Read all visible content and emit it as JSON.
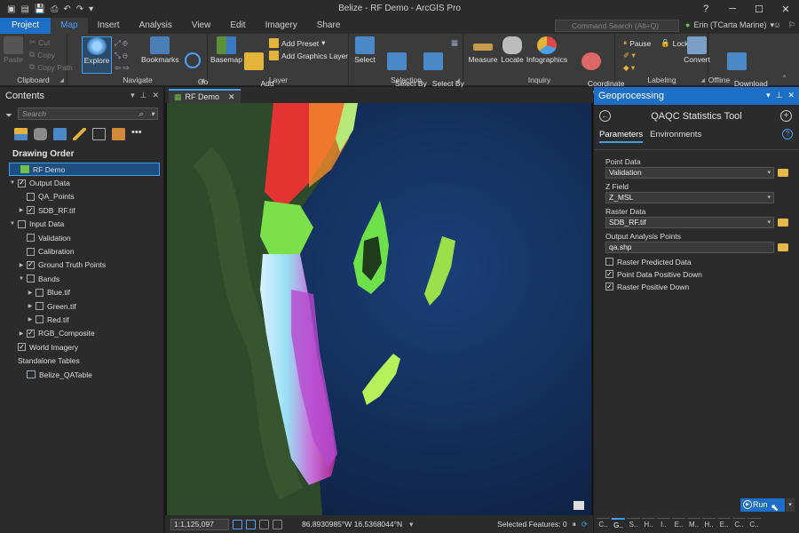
{
  "window": {
    "title": "Belize - RF Demo - ArcGIS Pro"
  },
  "ribbon_tabs": [
    {
      "label": "Project",
      "name": "tab-project"
    },
    {
      "label": "Map",
      "name": "tab-map"
    },
    {
      "label": "Insert",
      "name": "tab-insert"
    },
    {
      "label": "Analysis",
      "name": "tab-analysis"
    },
    {
      "label": "View",
      "name": "tab-view"
    },
    {
      "label": "Edit",
      "name": "tab-edit"
    },
    {
      "label": "Imagery",
      "name": "tab-imagery"
    },
    {
      "label": "Share",
      "name": "tab-share"
    }
  ],
  "command_search": {
    "placeholder": "Command Search (Alt+Q)"
  },
  "user": {
    "name": "Erin (TCarta Marine)"
  },
  "ribbon": {
    "clipboard": {
      "label": "Clipboard",
      "paste": "Paste",
      "cut": "Cut",
      "copy": "Copy",
      "copy_path": "Copy Path"
    },
    "navigate": {
      "label": "Navigate",
      "explore": "Explore",
      "bookmarks": "Bookmarks",
      "goto": "Go\nTo XY"
    },
    "layer": {
      "label": "Layer",
      "basemap": "Basemap",
      "add_data": "Add\nData",
      "add_preset": "Add Preset",
      "add_graphics": "Add Graphics Layer"
    },
    "selection": {
      "label": "Selection",
      "select": "Select",
      "by_attr": "Select By\nAttributes",
      "by_loc": "Select By\nLocation"
    },
    "inquiry": {
      "label": "Inquiry",
      "measure": "Measure",
      "locate": "Locate",
      "infographics": "Infographics",
      "coord": "Coordinate\nConversion"
    },
    "labeling": {
      "label": "Labeling",
      "pause": "Pause",
      "lock": "Lock"
    },
    "offline": {
      "label": "Offline",
      "convert": "Convert",
      "download": "Download\nMap"
    }
  },
  "contents": {
    "title": "Contents",
    "search_placeholder": "Search",
    "drawing_order": "Drawing Order",
    "tree": [
      {
        "label": "RF Demo",
        "indent": 0,
        "toggle": "",
        "check": "none",
        "icon": "map",
        "selected": true
      },
      {
        "label": "Output Data",
        "indent": 0,
        "toggle": "▼",
        "check": "on",
        "icon": "none"
      },
      {
        "label": "QA_Points",
        "indent": 1,
        "toggle": "",
        "check": "off",
        "icon": "none"
      },
      {
        "label": "SDB_RF.tif",
        "indent": 1,
        "toggle": "▶",
        "check": "on",
        "icon": "none"
      },
      {
        "label": "Input Data",
        "indent": 0,
        "toggle": "▼",
        "check": "off",
        "icon": "none"
      },
      {
        "label": "Validation",
        "indent": 1,
        "toggle": "",
        "check": "off",
        "icon": "none"
      },
      {
        "label": "Calibration",
        "indent": 1,
        "toggle": "",
        "check": "off",
        "icon": "none"
      },
      {
        "label": "Ground Truth Points",
        "indent": 1,
        "toggle": "▶",
        "check": "on",
        "icon": "none"
      },
      {
        "label": "Bands",
        "indent": 1,
        "toggle": "▼",
        "check": "off",
        "icon": "none"
      },
      {
        "label": "Blue.tif",
        "indent": 2,
        "toggle": "▶",
        "check": "off",
        "icon": "none"
      },
      {
        "label": "Green.tif",
        "indent": 2,
        "toggle": "▶",
        "check": "off",
        "icon": "none"
      },
      {
        "label": "Red.tif",
        "indent": 2,
        "toggle": "▶",
        "check": "off",
        "icon": "none"
      },
      {
        "label": "RGB_Composite",
        "indent": 1,
        "toggle": "▶",
        "check": "on",
        "icon": "none"
      },
      {
        "label": "World Imagery",
        "indent": 0,
        "toggle": "",
        "check": "on",
        "icon": "none"
      },
      {
        "label": "Standalone Tables",
        "indent": 0,
        "toggle": "",
        "check": "none",
        "icon": "none"
      },
      {
        "label": "Belize_QATable",
        "indent": 1,
        "toggle": "",
        "check": "none",
        "icon": "table"
      }
    ]
  },
  "map": {
    "tab_label": "RF Demo",
    "scale": "1:1,125,097",
    "coordinates": "86.8930985°W 16.5368044°N",
    "selected_features": "Selected Features: 0"
  },
  "geoprocessing": {
    "title": "Geoprocessing",
    "tool_name": "QAQC Statistics Tool",
    "tabs": [
      "Parameters",
      "Environments"
    ],
    "params": [
      {
        "label": "Point Data",
        "value": "Validation",
        "dropdown": true,
        "folder": true
      },
      {
        "label": "Z Field",
        "value": "Z_MSL",
        "dropdown": true,
        "folder": false
      },
      {
        "label": "Raster Data",
        "value": "SDB_RF.tif",
        "dropdown": true,
        "folder": true
      },
      {
        "label": "Output Analysis Points",
        "value": "qa.shp",
        "dropdown": false,
        "folder": true
      }
    ],
    "checks": [
      {
        "label": "Raster Predicted Data",
        "checked": false
      },
      {
        "label": "Point Data Positive Down",
        "checked": true
      },
      {
        "label": "Raster Positive Down",
        "checked": true
      }
    ],
    "run_label": "Run",
    "bottom_tabs": [
      "C..",
      "G..",
      "S..",
      "H..",
      "I..",
      "E..",
      "M..",
      "H..",
      "E..",
      "C..",
      "C.."
    ]
  }
}
